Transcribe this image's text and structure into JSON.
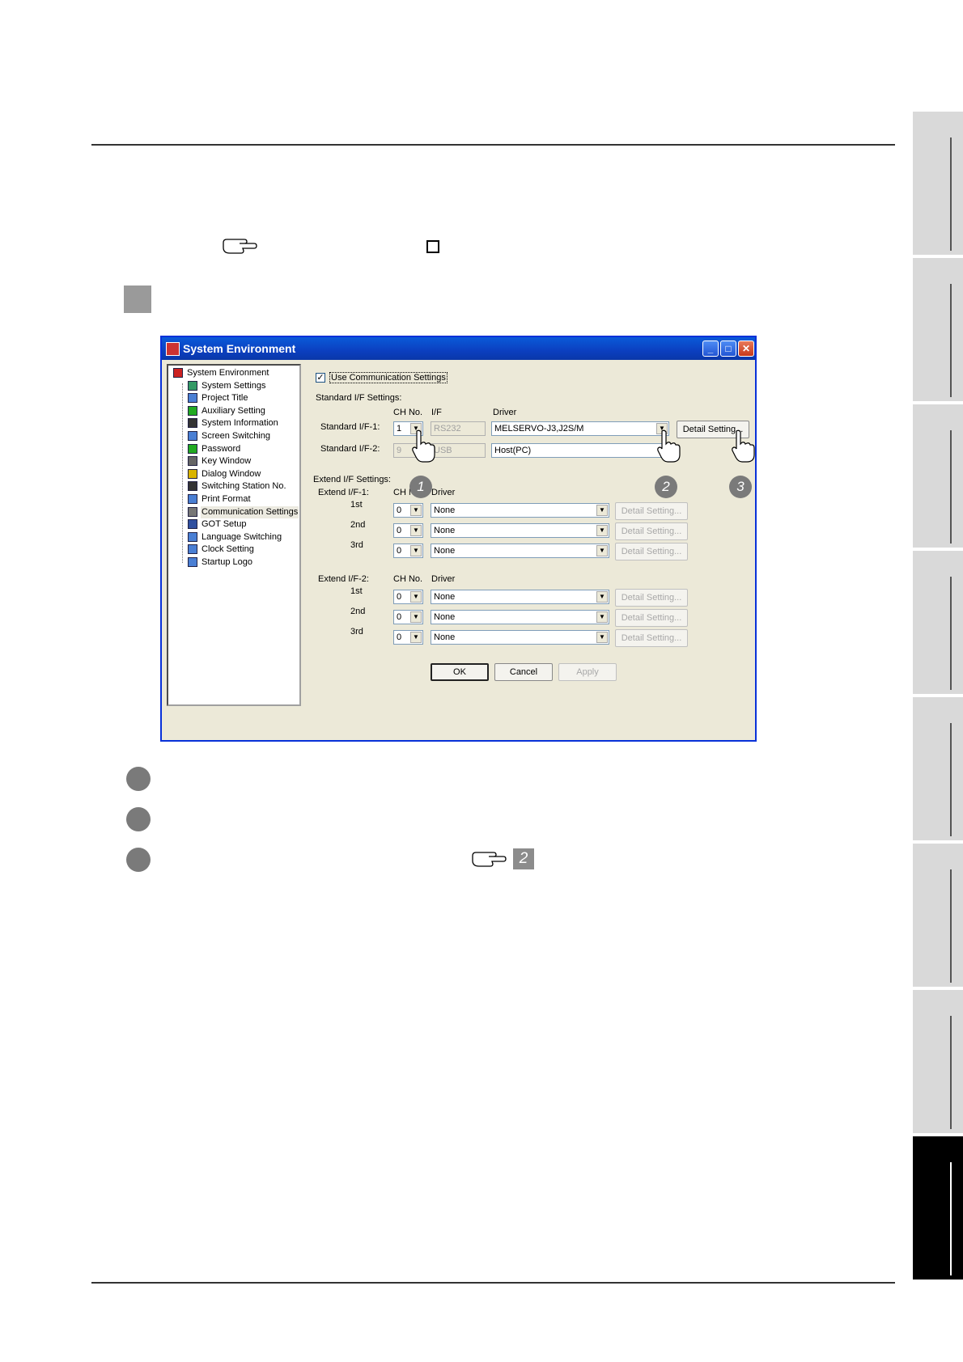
{
  "page": {
    "reference_number": "2",
    "callouts": [
      "1",
      "2",
      "3"
    ]
  },
  "window": {
    "title": "System Environment",
    "controls": {
      "minimize": "_",
      "maximize": "□",
      "close": "✕"
    },
    "tree": [
      {
        "label": "System Environment",
        "icon": "system-environment-icon",
        "color": "#c22"
      },
      {
        "label": "System Settings",
        "icon": "system-settings-icon",
        "color": "#396"
      },
      {
        "label": "Project Title",
        "icon": "project-title-icon",
        "color": "#4a7fd4"
      },
      {
        "label": "Auxiliary Setting",
        "icon": "auxiliary-setting-icon",
        "color": "#2a2"
      },
      {
        "label": "System Information",
        "icon": "system-information-icon",
        "color": "#333"
      },
      {
        "label": "Screen Switching",
        "icon": "screen-switching-icon",
        "color": "#4a7fd4"
      },
      {
        "label": "Password",
        "icon": "password-icon",
        "color": "#2a2"
      },
      {
        "label": "Key Window",
        "icon": "key-window-icon",
        "color": "#666"
      },
      {
        "label": "Dialog Window",
        "icon": "dialog-window-icon",
        "color": "#d9b400"
      },
      {
        "label": "Switching Station No.",
        "icon": "switching-station-icon",
        "color": "#333"
      },
      {
        "label": "Print Format",
        "icon": "print-format-icon",
        "color": "#4a7fd4"
      },
      {
        "label": "Communication Settings",
        "icon": "communication-settings-icon",
        "color": "#777",
        "selected": true
      },
      {
        "label": "GOT Setup",
        "icon": "got-setup-icon",
        "color": "#2f4f9f"
      },
      {
        "label": "Language Switching",
        "icon": "language-switching-icon",
        "color": "#4a7fd4"
      },
      {
        "label": "Clock Setting",
        "icon": "clock-setting-icon",
        "color": "#4a7fd4"
      },
      {
        "label": "Startup Logo",
        "icon": "startup-logo-icon",
        "color": "#4a7fd4"
      }
    ],
    "use_comm_label": "Use Communication Settings",
    "use_comm_checked": "✓",
    "standard_if_settings_label": "Standard I/F Settings:",
    "col_ch_no": "CH No.",
    "col_if": "I/F",
    "col_driver": "Driver",
    "standard_if1": {
      "label": "Standard I/F-1:",
      "ch": "1",
      "if": "RS232",
      "driver": "MELSERVO-J3,J2S/M",
      "detail": "Detail Setting..."
    },
    "standard_if2": {
      "label": "Standard I/F-2:",
      "ch": "9",
      "if": "USB",
      "driver": "Host(PC)"
    },
    "extend_if_settings_label": "Extend I/F Settings:",
    "extend_if1": {
      "label": "Extend I/F-1:",
      "col_ch_no": "CH N",
      "col_driver": "Driver",
      "rows": [
        {
          "label": "1st",
          "ch": "0",
          "driver": "None",
          "detail": "Detail Setting..."
        },
        {
          "label": "2nd",
          "ch": "0",
          "driver": "None",
          "detail": "Detail Setting..."
        },
        {
          "label": "3rd",
          "ch": "0",
          "driver": "None",
          "detail": "Detail Setting..."
        }
      ]
    },
    "extend_if2": {
      "label": "Extend I/F-2:",
      "col_ch_no": "CH No.",
      "col_driver": "Driver",
      "rows": [
        {
          "label": "1st",
          "ch": "0",
          "driver": "None",
          "detail": "Detail Setting..."
        },
        {
          "label": "2nd",
          "ch": "0",
          "driver": "None",
          "detail": "Detail Setting..."
        },
        {
          "label": "3rd",
          "ch": "0",
          "driver": "None",
          "detail": "Detail Setting..."
        }
      ]
    },
    "buttons": {
      "ok": "OK",
      "cancel": "Cancel",
      "apply": "Apply"
    }
  }
}
